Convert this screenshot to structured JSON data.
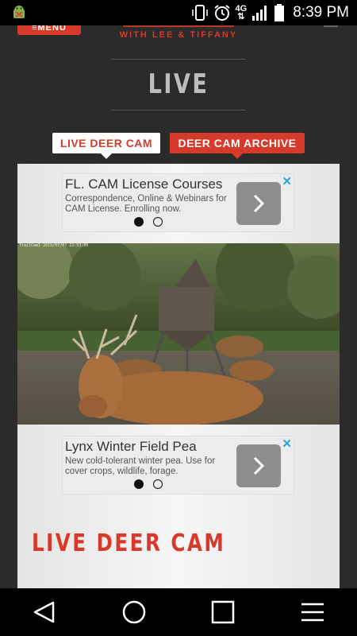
{
  "status_bar": {
    "time": "8:39 PM",
    "network": "4G",
    "icons": [
      "android-debug-icon",
      "vibrate-icon",
      "alarm-icon",
      "network-4g-icon",
      "signal-icon",
      "battery-icon"
    ]
  },
  "header": {
    "menu_label": "≡MENU",
    "logo_tagline": "WITH LEE & TIFFANY",
    "page_title": "LIVE"
  },
  "tabs": {
    "live_label": "LIVE DEER CAM",
    "archive_label": "DEER CAM ARCHIVE"
  },
  "ads": [
    {
      "title": "FL. CAM License Courses",
      "body": "Correspondence, Online & Webinars for CAM License. Enrolling now.",
      "arrow_icon": "chevron-right-icon",
      "close_icon": "close-icon"
    },
    {
      "title": "Lynx Winter Field Pea",
      "body": "New cold-tolerant winter pea. Use for cover crops, wildlife, forage.",
      "arrow_icon": "chevron-right-icon",
      "close_icon": "close-icon"
    }
  ],
  "camera": {
    "timestamp": "TrailCam1  2015/07/07  22:53:09"
  },
  "section_heading": "LIVE DEER CAM",
  "colors": {
    "brand_red": "#d63a2a",
    "background": "#2b2b2b",
    "close_blue": "#2aa7d8"
  },
  "nav_bar": {
    "icons": [
      "back-icon",
      "home-icon",
      "recents-icon",
      "menu-icon"
    ]
  }
}
